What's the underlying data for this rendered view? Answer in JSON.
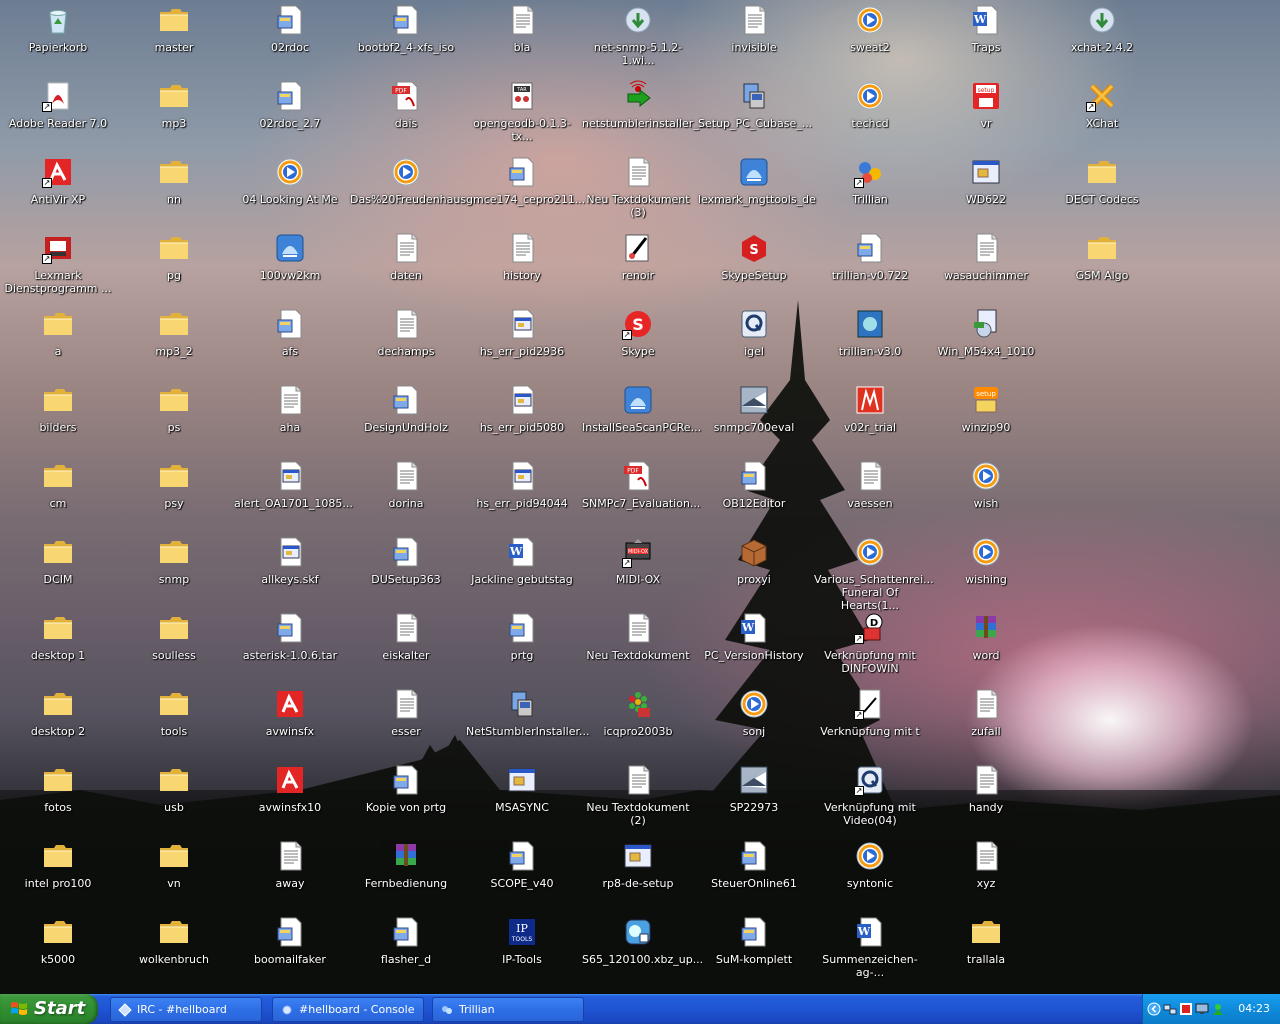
{
  "desktop": {
    "icons": [
      {
        "col": 0,
        "row": 0,
        "label": "Papierkorb",
        "icon": "recycle-bin-icon",
        "type": "recycle"
      },
      {
        "col": 0,
        "row": 1,
        "label": "Adobe Reader 7.0",
        "icon": "adobe-reader-icon",
        "type": "adobe",
        "shortcut": true
      },
      {
        "col": 0,
        "row": 2,
        "label": "AntiVir XP",
        "icon": "antivir-icon",
        "type": "antivir",
        "shortcut": true
      },
      {
        "col": 0,
        "row": 3,
        "label": "Lexmark\nDienstprogramm ...",
        "icon": "lexmark-icon",
        "type": "lexmark",
        "shortcut": true
      },
      {
        "col": 0,
        "row": 4,
        "label": "a",
        "icon": "folder-icon",
        "type": "folder"
      },
      {
        "col": 0,
        "row": 5,
        "label": "bilders",
        "icon": "folder-icon",
        "type": "folder"
      },
      {
        "col": 0,
        "row": 6,
        "label": "cm",
        "icon": "folder-icon",
        "type": "folder"
      },
      {
        "col": 0,
        "row": 7,
        "label": "DCIM",
        "icon": "folder-icon",
        "type": "folder"
      },
      {
        "col": 0,
        "row": 8,
        "label": "desktop 1",
        "icon": "folder-icon",
        "type": "folder"
      },
      {
        "col": 0,
        "row": 9,
        "label": "desktop 2",
        "icon": "folder-icon",
        "type": "folder"
      },
      {
        "col": 0,
        "row": 10,
        "label": "fotos",
        "icon": "folder-icon",
        "type": "folder"
      },
      {
        "col": 0,
        "row": 11,
        "label": "intel pro100",
        "icon": "folder-icon",
        "type": "folder"
      },
      {
        "col": 0,
        "row": 12,
        "label": "k5000",
        "icon": "folder-icon",
        "type": "folder"
      },
      {
        "col": 1,
        "row": 0,
        "label": "master",
        "icon": "folder-icon",
        "type": "folder"
      },
      {
        "col": 1,
        "row": 1,
        "label": "mp3",
        "icon": "folder-icon",
        "type": "folder"
      },
      {
        "col": 1,
        "row": 2,
        "label": "nn",
        "icon": "folder-icon",
        "type": "folder"
      },
      {
        "col": 1,
        "row": 3,
        "label": "pg",
        "icon": "folder-icon",
        "type": "folder"
      },
      {
        "col": 1,
        "row": 4,
        "label": "mp3_2",
        "icon": "folder-icon",
        "type": "folder"
      },
      {
        "col": 1,
        "row": 5,
        "label": "ps",
        "icon": "folder-icon",
        "type": "folder"
      },
      {
        "col": 1,
        "row": 6,
        "label": "psy",
        "icon": "folder-icon",
        "type": "folder"
      },
      {
        "col": 1,
        "row": 7,
        "label": "snmp",
        "icon": "folder-icon",
        "type": "folder"
      },
      {
        "col": 1,
        "row": 8,
        "label": "soulless",
        "icon": "folder-icon",
        "type": "folder"
      },
      {
        "col": 1,
        "row": 9,
        "label": "tools",
        "icon": "folder-icon",
        "type": "folder"
      },
      {
        "col": 1,
        "row": 10,
        "label": "usb",
        "icon": "folder-icon",
        "type": "folder"
      },
      {
        "col": 1,
        "row": 11,
        "label": "vn",
        "icon": "folder-icon",
        "type": "folder"
      },
      {
        "col": 1,
        "row": 12,
        "label": "wolkenbruch",
        "icon": "folder-icon",
        "type": "folder"
      },
      {
        "col": 2,
        "row": 0,
        "label": "02rdoc",
        "icon": "file-icon",
        "type": "filegear"
      },
      {
        "col": 2,
        "row": 1,
        "label": "02rdoc_2.7",
        "icon": "file-icon",
        "type": "filegear"
      },
      {
        "col": 2,
        "row": 2,
        "label": "04 Looking At Me",
        "icon": "media-file-icon",
        "type": "media"
      },
      {
        "col": 2,
        "row": 3,
        "label": "100vw2km",
        "icon": "installer-icon",
        "type": "installer"
      },
      {
        "col": 2,
        "row": 4,
        "label": "afs",
        "icon": "file-icon",
        "type": "filegear"
      },
      {
        "col": 2,
        "row": 5,
        "label": "aha",
        "icon": "text-file-icon",
        "type": "text"
      },
      {
        "col": 2,
        "row": 6,
        "label": "alert_OA1701_1085...",
        "icon": "log-file-icon",
        "type": "log"
      },
      {
        "col": 2,
        "row": 7,
        "label": "allkeys.skf",
        "icon": "log-file-icon",
        "type": "log"
      },
      {
        "col": 2,
        "row": 8,
        "label": "asterisk-1.0.6.tar",
        "icon": "file-icon",
        "type": "filegear"
      },
      {
        "col": 2,
        "row": 9,
        "label": "avwinsfx",
        "icon": "antivir-icon",
        "type": "antivir"
      },
      {
        "col": 2,
        "row": 10,
        "label": "avwinsfx10",
        "icon": "antivir-icon",
        "type": "antivir"
      },
      {
        "col": 2,
        "row": 11,
        "label": "away",
        "icon": "text-file-icon",
        "type": "text"
      },
      {
        "col": 2,
        "row": 12,
        "label": "boomailfaker",
        "icon": "file-icon",
        "type": "filegear"
      },
      {
        "col": 3,
        "row": 0,
        "label": "bootbf2_4-xfs_iso",
        "icon": "file-icon",
        "type": "filegear"
      },
      {
        "col": 3,
        "row": 1,
        "label": "dais",
        "icon": "pdf-icon",
        "type": "pdf"
      },
      {
        "col": 3,
        "row": 2,
        "label": "Das%20Freudenhaus",
        "icon": "media-file-icon",
        "type": "media"
      },
      {
        "col": 3,
        "row": 3,
        "label": "daten",
        "icon": "text-file-icon",
        "type": "text"
      },
      {
        "col": 3,
        "row": 4,
        "label": "dechamps",
        "icon": "text-file-icon",
        "type": "text"
      },
      {
        "col": 3,
        "row": 5,
        "label": "DesignUndHolz",
        "icon": "file-icon",
        "type": "filegear"
      },
      {
        "col": 3,
        "row": 6,
        "label": "dorina",
        "icon": "text-file-icon",
        "type": "text"
      },
      {
        "col": 3,
        "row": 7,
        "label": "DUSetup363",
        "icon": "file-icon",
        "type": "filegear"
      },
      {
        "col": 3,
        "row": 8,
        "label": "eiskalter",
        "icon": "text-file-icon",
        "type": "text"
      },
      {
        "col": 3,
        "row": 9,
        "label": "esser",
        "icon": "text-file-icon",
        "type": "text"
      },
      {
        "col": 3,
        "row": 10,
        "label": "Kopie von prtg",
        "icon": "file-icon",
        "type": "filegear"
      },
      {
        "col": 3,
        "row": 11,
        "label": "Fernbedienung",
        "icon": "winrar-icon",
        "type": "winrar"
      },
      {
        "col": 3,
        "row": 12,
        "label": "flasher_d",
        "icon": "file-icon",
        "type": "filegear"
      },
      {
        "col": 4,
        "row": 0,
        "label": "bla",
        "icon": "text-file-icon",
        "type": "text"
      },
      {
        "col": 4,
        "row": 1,
        "label": "opengeodb-0.1.3-tx...",
        "icon": "tar-icon",
        "type": "tar"
      },
      {
        "col": 4,
        "row": 2,
        "label": "gmce174_cepro211...",
        "icon": "file-icon",
        "type": "filegear"
      },
      {
        "col": 4,
        "row": 3,
        "label": "history",
        "icon": "text-file-icon",
        "type": "text"
      },
      {
        "col": 4,
        "row": 4,
        "label": "hs_err_pid2936",
        "icon": "log-file-icon",
        "type": "log"
      },
      {
        "col": 4,
        "row": 5,
        "label": "hs_err_pid5080",
        "icon": "log-file-icon",
        "type": "log"
      },
      {
        "col": 4,
        "row": 6,
        "label": "hs_err_pid94044",
        "icon": "log-file-icon",
        "type": "log"
      },
      {
        "col": 4,
        "row": 7,
        "label": "Jackline gebutstag",
        "icon": "word-doc-icon",
        "type": "word"
      },
      {
        "col": 4,
        "row": 8,
        "label": "prtg",
        "icon": "file-icon",
        "type": "filegear"
      },
      {
        "col": 4,
        "row": 9,
        "label": "NetStumblerInstaller...",
        "icon": "setup-icon",
        "type": "setup"
      },
      {
        "col": 4,
        "row": 10,
        "label": "MSASYNC",
        "icon": "app-window-icon",
        "type": "appwin"
      },
      {
        "col": 4,
        "row": 11,
        "label": "SCOPE_v40",
        "icon": "file-icon",
        "type": "filegear"
      },
      {
        "col": 4,
        "row": 12,
        "label": "IP-Tools",
        "icon": "ip-tools-icon",
        "type": "iptools"
      },
      {
        "col": 5,
        "row": 0,
        "label": "net-snmp-5.1.2-1.wi...",
        "icon": "nsis-installer-icon",
        "type": "nsis"
      },
      {
        "col": 5,
        "row": 1,
        "label": "netstumblerinstaller_...",
        "icon": "netstumbler-icon",
        "type": "netstumbler"
      },
      {
        "col": 5,
        "row": 2,
        "label": "Neu Textdokument (3)",
        "icon": "text-file-icon",
        "type": "text"
      },
      {
        "col": 5,
        "row": 3,
        "label": "renoir",
        "icon": "paint-icon",
        "type": "paint"
      },
      {
        "col": 5,
        "row": 4,
        "label": "Skype",
        "icon": "skype-icon",
        "type": "skype",
        "shortcut": true
      },
      {
        "col": 5,
        "row": 5,
        "label": "InstallSeaScanPCRe...",
        "icon": "installer-icon",
        "type": "installer"
      },
      {
        "col": 5,
        "row": 6,
        "label": "SNMPc7_Evaluation...",
        "icon": "pdf-icon",
        "type": "pdf"
      },
      {
        "col": 5,
        "row": 7,
        "label": "MIDI-OX",
        "icon": "midi-ox-icon",
        "type": "midiox",
        "shortcut": true
      },
      {
        "col": 5,
        "row": 8,
        "label": "Neu Textdokument",
        "icon": "text-file-icon",
        "type": "text"
      },
      {
        "col": 5,
        "row": 9,
        "label": "icqpro2003b",
        "icon": "icq-icon",
        "type": "icq"
      },
      {
        "col": 5,
        "row": 10,
        "label": "Neu Textdokument (2)",
        "icon": "text-file-icon",
        "type": "text"
      },
      {
        "col": 5,
        "row": 11,
        "label": "rp8-de-setup",
        "icon": "app-window-icon",
        "type": "appwin"
      },
      {
        "col": 5,
        "row": 12,
        "label": "S65_120100.xbz_up...",
        "icon": "phone-update-icon",
        "type": "phone"
      },
      {
        "col": 6,
        "row": 0,
        "label": "invisible",
        "icon": "text-file-icon",
        "type": "text"
      },
      {
        "col": 6,
        "row": 1,
        "label": "Setup_PC_Cubase_...",
        "icon": "setup-icon",
        "type": "setup"
      },
      {
        "col": 6,
        "row": 2,
        "label": "lexmark_mgttools_de",
        "icon": "installer-icon",
        "type": "installer"
      },
      {
        "col": 6,
        "row": 3,
        "label": "SkypeSetup",
        "icon": "skype-setup-icon",
        "type": "skypesetup"
      },
      {
        "col": 6,
        "row": 4,
        "label": "igel",
        "icon": "igel-icon",
        "type": "igel"
      },
      {
        "col": 6,
        "row": 5,
        "label": "snmpc700eval",
        "icon": "snmpc-icon",
        "type": "snmpc"
      },
      {
        "col": 6,
        "row": 6,
        "label": "OB12Editor",
        "icon": "file-icon",
        "type": "filegear"
      },
      {
        "col": 6,
        "row": 7,
        "label": "proxyi",
        "icon": "package-icon",
        "type": "package"
      },
      {
        "col": 6,
        "row": 8,
        "label": "PC_VersionHistory",
        "icon": "word-doc-icon",
        "type": "word"
      },
      {
        "col": 6,
        "row": 9,
        "label": "sonj",
        "icon": "media-file-icon",
        "type": "media"
      },
      {
        "col": 6,
        "row": 10,
        "label": "SP22973",
        "icon": "snmpc-icon",
        "type": "snmpc"
      },
      {
        "col": 6,
        "row": 11,
        "label": "SteuerOnline61",
        "icon": "file-icon",
        "type": "filegear"
      },
      {
        "col": 6,
        "row": 12,
        "label": "SuM-komplett",
        "icon": "file-icon",
        "type": "filegear"
      },
      {
        "col": 7,
        "row": 0,
        "label": "sweat2",
        "icon": "media-file-icon",
        "type": "media"
      },
      {
        "col": 7,
        "row": 1,
        "label": "techcd",
        "icon": "media-file-icon",
        "type": "media"
      },
      {
        "col": 7,
        "row": 2,
        "label": "Trillian",
        "icon": "trillian-icon",
        "type": "trillian",
        "shortcut": true
      },
      {
        "col": 7,
        "row": 3,
        "label": "trillian-v0.722",
        "icon": "file-icon",
        "type": "filegear"
      },
      {
        "col": 7,
        "row": 4,
        "label": "trillian-v3.0",
        "icon": "trillian-setup-icon",
        "type": "trilliansetup"
      },
      {
        "col": 7,
        "row": 5,
        "label": "v02r_trial",
        "icon": "v02r-icon",
        "type": "v02r"
      },
      {
        "col": 7,
        "row": 6,
        "label": "vaessen",
        "icon": "text-file-icon",
        "type": "text"
      },
      {
        "col": 7,
        "row": 7,
        "label": "Various_Schattenrei...\nFuneral Of Hearts(1...",
        "icon": "media-file-icon",
        "type": "media"
      },
      {
        "col": 7,
        "row": 8,
        "label": "Verknüpfung mit\nDINFOWIN",
        "icon": "dinfowin-icon",
        "type": "dinfowin",
        "shortcut": true
      },
      {
        "col": 7,
        "row": 9,
        "label": "Verknüpfung mit t",
        "icon": "shortcut-file-icon",
        "type": "shortcutfile",
        "shortcut": true
      },
      {
        "col": 7,
        "row": 10,
        "label": "Verknüpfung mit\nVideo(04)",
        "icon": "igel-icon",
        "type": "igel",
        "shortcut": true
      },
      {
        "col": 7,
        "row": 11,
        "label": "syntonic",
        "icon": "media-file-icon",
        "type": "media"
      },
      {
        "col": 7,
        "row": 12,
        "label": "Summenzeichen-ag-...",
        "icon": "word-doc-icon",
        "type": "word"
      },
      {
        "col": 8,
        "row": 0,
        "label": "Traps",
        "icon": "word-doc-icon",
        "type": "word"
      },
      {
        "col": 8,
        "row": 1,
        "label": "vr",
        "icon": "setup-disk-icon",
        "type": "setupdisk"
      },
      {
        "col": 8,
        "row": 2,
        "label": "WD622",
        "icon": "app-window-icon",
        "type": "appwin"
      },
      {
        "col": 8,
        "row": 3,
        "label": "wasauchimmer",
        "icon": "text-file-icon",
        "type": "text"
      },
      {
        "col": 8,
        "row": 4,
        "label": "Win_M54x4_1010",
        "icon": "win-setup-icon",
        "type": "winsetup"
      },
      {
        "col": 8,
        "row": 5,
        "label": "winzip90",
        "icon": "winzip-setup-icon",
        "type": "winzipsetup"
      },
      {
        "col": 8,
        "row": 6,
        "label": "wish",
        "icon": "media-file-icon",
        "type": "media"
      },
      {
        "col": 8,
        "row": 7,
        "label": "wishing",
        "icon": "media-file-icon",
        "type": "media"
      },
      {
        "col": 8,
        "row": 8,
        "label": "word",
        "icon": "winrar-icon",
        "type": "winrar"
      },
      {
        "col": 8,
        "row": 9,
        "label": "zufall",
        "icon": "text-file-icon",
        "type": "text"
      },
      {
        "col": 8,
        "row": 10,
        "label": "handy",
        "icon": "text-file-icon",
        "type": "text"
      },
      {
        "col": 8,
        "row": 11,
        "label": "xyz",
        "icon": "text-file-icon",
        "type": "text"
      },
      {
        "col": 8,
        "row": 12,
        "label": "trallala",
        "icon": "folder-icon",
        "type": "folder"
      },
      {
        "col": 9,
        "row": 0,
        "label": "xchat-2.4.2",
        "icon": "nsis-installer-icon",
        "type": "nsis"
      },
      {
        "col": 9,
        "row": 1,
        "label": "XChat",
        "icon": "xchat-icon",
        "type": "xchat",
        "shortcut": true
      },
      {
        "col": 9,
        "row": 2,
        "label": "DECT Codecs",
        "icon": "folder-icon",
        "type": "folder"
      },
      {
        "col": 9,
        "row": 3,
        "label": "GSM Algo",
        "icon": "folder-icon",
        "type": "folder"
      }
    ]
  },
  "taskbar": {
    "start_label": "Start",
    "tasks": [
      {
        "label": "IRC - #hellboard",
        "icon": "xchat-icon"
      },
      {
        "label": "#hellboard - Console",
        "icon": "console-icon"
      },
      {
        "label": "Trillian",
        "icon": "trillian-icon"
      }
    ],
    "clock": "04:23",
    "tray_icons": [
      "chevron-left-icon",
      "network-icon",
      "antivir-tray-icon",
      "monitor-icon",
      "trillian-tray-icon"
    ]
  },
  "colors": {
    "taskbar_blue": "#245edb",
    "start_green": "#3c9a3c",
    "tray_blue": "#0f8bdc",
    "folder_yellow": "#f5d46a"
  }
}
